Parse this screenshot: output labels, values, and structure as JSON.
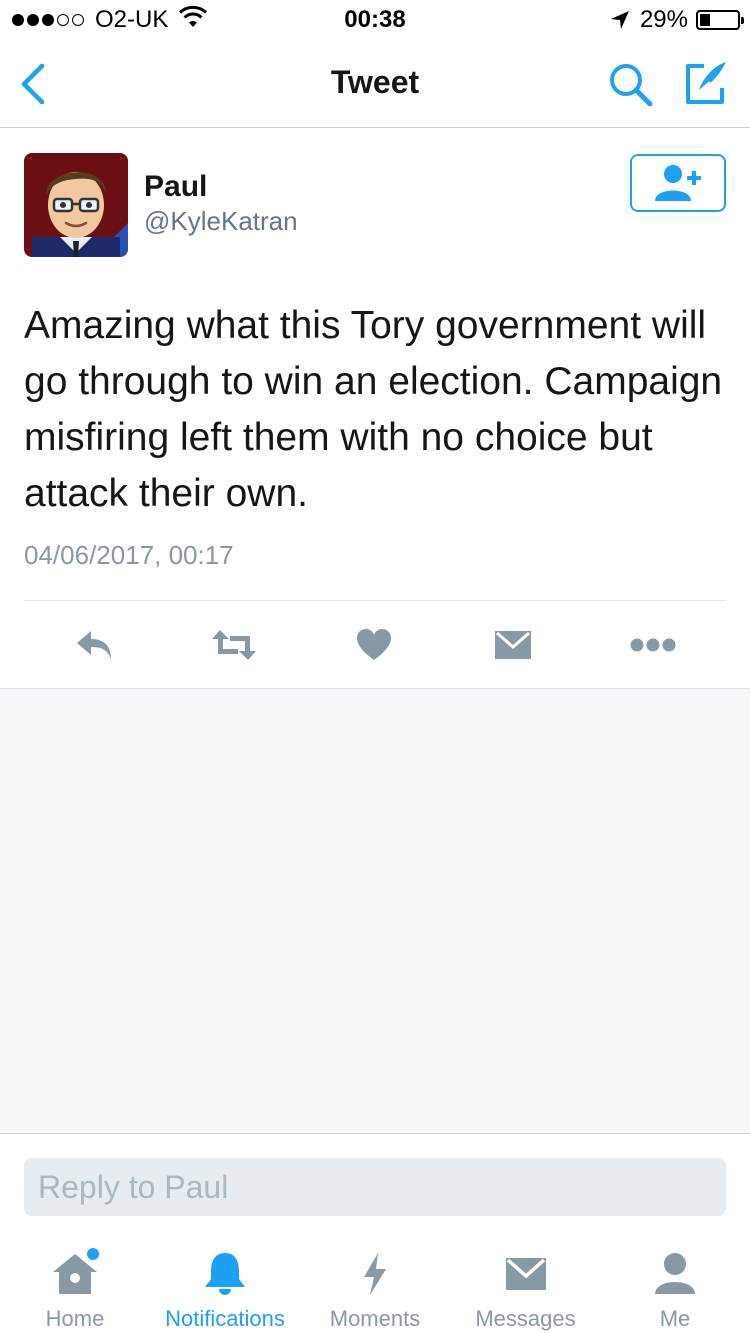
{
  "status_bar": {
    "carrier": "O2-UK",
    "signal_bars_filled": 3,
    "signal_bars_total": 5,
    "time": "00:38",
    "battery_percent": "29%",
    "battery_level": 0.29
  },
  "nav": {
    "title": "Tweet",
    "back_icon": "chevron-left-icon",
    "search_icon": "search-icon",
    "compose_icon": "compose-icon"
  },
  "tweet": {
    "author_name": "Paul",
    "author_handle": "@KyleKatran",
    "text": "Amazing what this Tory government will go through to win an election. Campaign misfiring left them with no choice but attack their own.",
    "timestamp": "04/06/2017, 00:17",
    "follow_icon": "add-user-icon"
  },
  "actions": [
    {
      "name": "reply",
      "icon": "reply-icon"
    },
    {
      "name": "retweet",
      "icon": "retweet-icon"
    },
    {
      "name": "like",
      "icon": "heart-icon"
    },
    {
      "name": "direct-message",
      "icon": "envelope-icon"
    },
    {
      "name": "more",
      "icon": "more-icon"
    }
  ],
  "reply": {
    "placeholder": "Reply to Paul"
  },
  "tabs": [
    {
      "label": "Home",
      "icon": "home-icon",
      "active": false,
      "has_dot": true
    },
    {
      "label": "Notifications",
      "icon": "bell-icon",
      "active": true
    },
    {
      "label": "Moments",
      "icon": "lightning-icon",
      "active": false
    },
    {
      "label": "Messages",
      "icon": "envelope-icon",
      "active": false
    },
    {
      "label": "Me",
      "icon": "person-icon",
      "active": false
    }
  ],
  "colors": {
    "accent": "#1da1f2",
    "icon_gray": "#8899a6",
    "background_gray": "#f5f8fa"
  }
}
